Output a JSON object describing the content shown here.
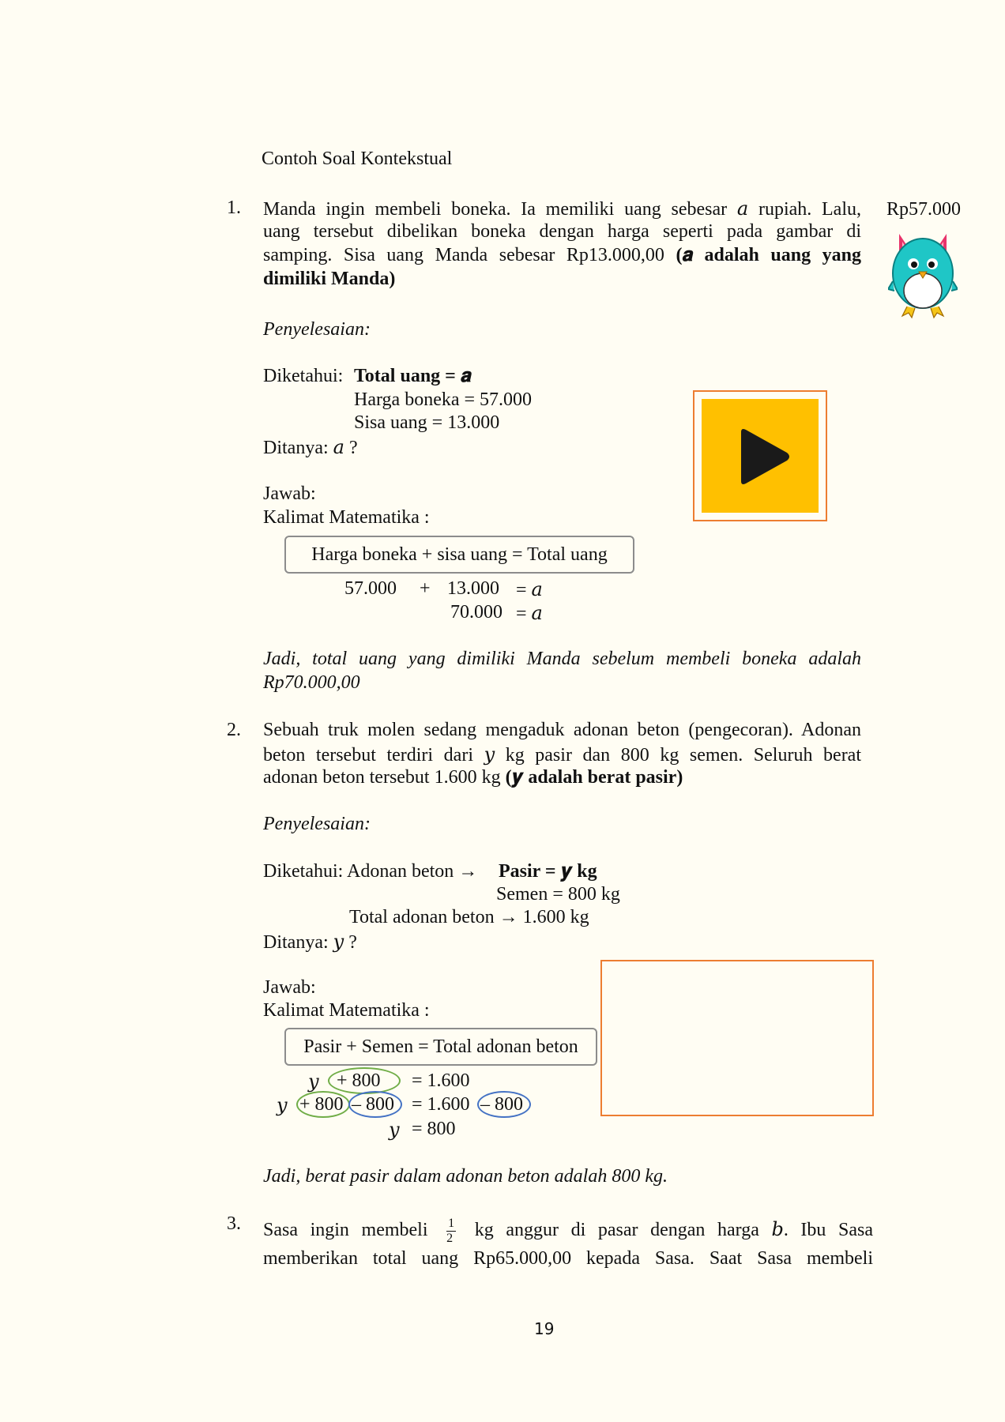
{
  "heading": "Contoh Soal Kontekstual",
  "q1": {
    "number": "1.",
    "line1": "Manda ingin membeli boneka. Ia memiliki uang sebesar 𝑎 rupiah. Lalu,",
    "line2": "uang tersebut dibelikan boneka dengan harga seperti pada gambar di",
    "line3_pre": "samping. Sisa uang Manda sebesar Rp13.000,00",
    "line3_bold": "(𝒂 adalah uang yang",
    "line4_bold": "dimiliki Manda)",
    "price_tag": "Rp57.000",
    "doll_icon": "furby-doll-icon",
    "play_icon": "play-icon",
    "solution_label": "Penyelesaian:",
    "known_label": "Diketahui:",
    "known_total": "Total uang = 𝒂",
    "known_price": "Harga boneka = 57.000",
    "known_rest": "Sisa uang = 13.000",
    "asked": "Ditanya: 𝑎 ?",
    "answer_label": "Jawab:",
    "math_sentence_label": "Kalimat Matematika :",
    "formula": "Harga boneka + sisa uang = Total uang",
    "eq1_a": "57.000",
    "eq1_op": "+",
    "eq1_b": "13.000",
    "eq1_r": "= 𝑎",
    "eq2_a": "70.000",
    "eq2_r": "= 𝑎",
    "conclusion_l1": "Jadi, total uang yang dimiliki Manda sebelum membeli boneka adalah",
    "conclusion_l2": "Rp70.000,00"
  },
  "q2": {
    "number": "2.",
    "line1": "Sebuah truk molen sedang mengaduk adonan beton (pengecoran). Adonan",
    "line2": "beton tersebut terdiri dari 𝑦 kg pasir dan 800 kg semen. Seluruh berat",
    "line3_pre": "adonan beton tersebut 1.600 kg",
    "line3_bold": "(𝒚 adalah berat pasir)",
    "solution_label": "Penyelesaian:",
    "known_label": "Diketahui: Adonan beton →",
    "known_sand": "Pasir = 𝒚 kg",
    "known_cement": "Semen = 800 kg",
    "known_total": "Total adonan beton → 1.600 kg",
    "asked": "Ditanya: 𝑦 ?",
    "answer_label": "Jawab:",
    "math_sentence_label": "Kalimat Matematika :",
    "formula": "Pasir + Semen = Total adonan beton",
    "eq1_y": "𝑦",
    "eq1_plus": "+   800",
    "eq1_r": "= 1.600",
    "eq2_y": "𝑦",
    "eq2_plus": "+ 800",
    "eq2_minus": "– 800",
    "eq2_r": "= 1.600",
    "eq2_minus2": "– 800",
    "eq3_y": "𝑦",
    "eq3_r": "= 800",
    "conclusion": "Jadi, berat pasir dalam adonan beton adalah 800 kg."
  },
  "q3": {
    "number": "3.",
    "l1_pre": "Sasa ingin membeli",
    "frac_num": "1",
    "frac_den": "2",
    "l1_post": "kg anggur di pasar dengan harga 𝑏. Ibu Sasa",
    "line2": "memberikan total uang Rp65.000,00 kepada Sasa. Saat Sasa membeli"
  },
  "page_number": "19",
  "colors": {
    "page_bg": "#fffdf3",
    "frame_orange": "#ed7d31",
    "play_yellow": "#ffc000",
    "oval_green": "#70ad47",
    "oval_blue": "#4472c4"
  }
}
